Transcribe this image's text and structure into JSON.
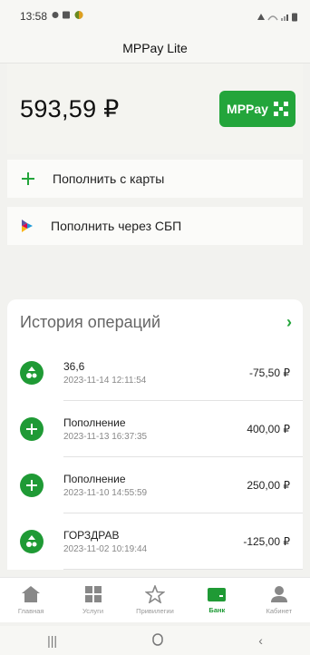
{
  "status_bar": {
    "time": "13:58",
    "right_icons": "wifi signal battery"
  },
  "app": {
    "title": "MPPay Lite"
  },
  "balance": {
    "amount": "593,59 ₽",
    "mppay_label": "MPPay"
  },
  "actions": {
    "topup_card": "Пополнить с карты",
    "topup_sbp": "Пополнить через СБП"
  },
  "history": {
    "title": "История операций",
    "operations": [
      {
        "title": "36,6",
        "date": "2023-11-14 12:11:54",
        "amount": "-75,50 ₽",
        "icon": "pharmacy-icon"
      },
      {
        "title": "Пополнение",
        "date": "2023-11-13 16:37:35",
        "amount": "400,00 ₽",
        "icon": "plus-icon"
      },
      {
        "title": "Пополнение",
        "date": "2023-11-10 14:55:59",
        "amount": "250,00 ₽",
        "icon": "plus-icon"
      },
      {
        "title": "ГОРЗДРАВ",
        "date": "2023-11-02 10:19:44",
        "amount": "-125,00 ₽",
        "icon": "pharmacy-icon"
      }
    ]
  },
  "nav": {
    "items": [
      {
        "label": "Главная",
        "icon": "home-icon"
      },
      {
        "label": "Услуги",
        "icon": "grid-icon"
      },
      {
        "label": "Привилегии",
        "icon": "star-icon"
      },
      {
        "label": "Банк",
        "icon": "wallet-icon",
        "active": true
      },
      {
        "label": "Кабинет",
        "icon": "user-icon"
      }
    ]
  },
  "colors": {
    "accent": "#23a53b",
    "background": "#f2f2ef"
  }
}
